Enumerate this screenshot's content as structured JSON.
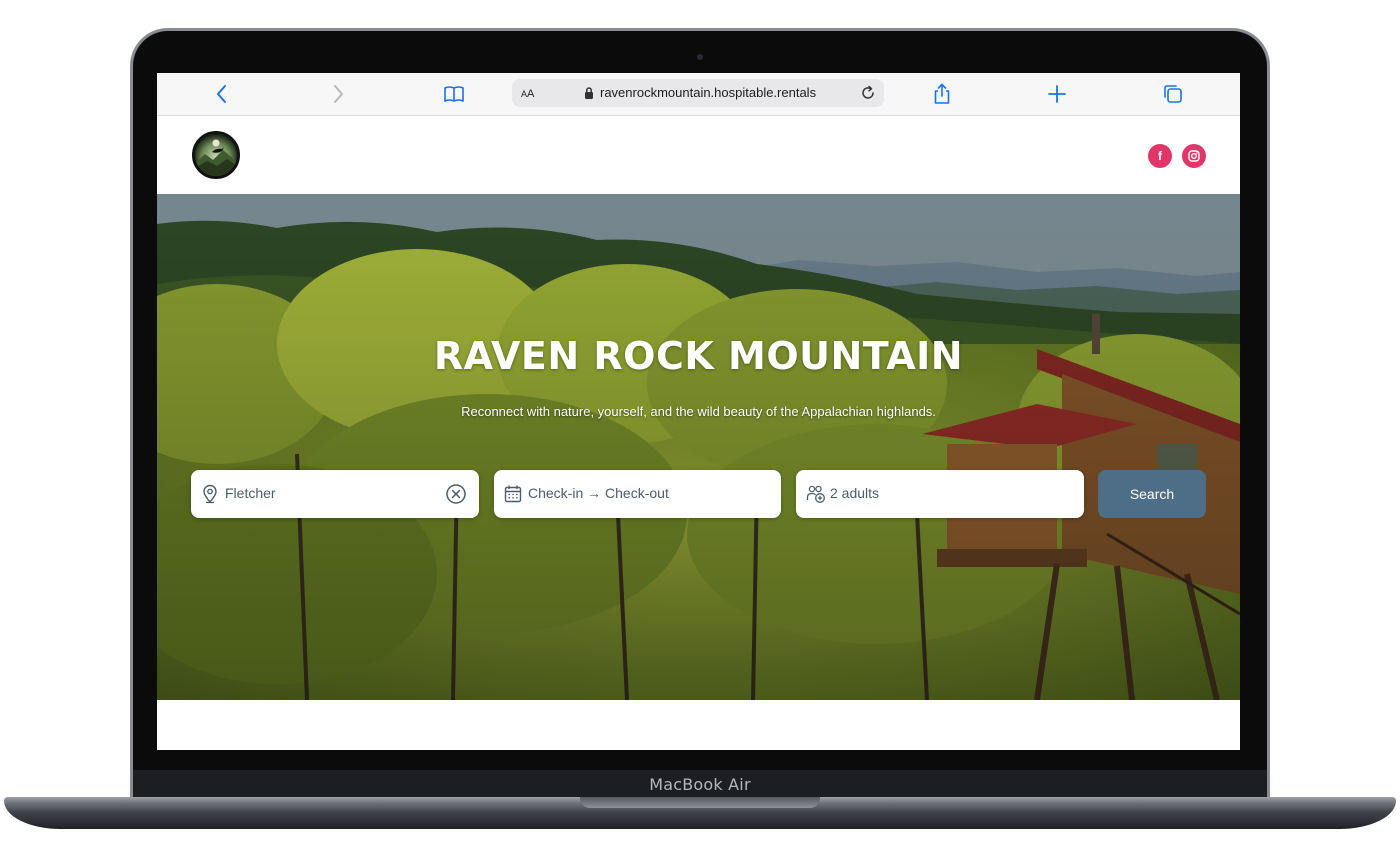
{
  "device": {
    "label": "MacBook Air"
  },
  "browser": {
    "text_size_label": "AA",
    "url": "ravenrockmountain.hospitable.rentals",
    "icons": [
      "back-icon",
      "forward-icon",
      "bookmarks-icon",
      "lock-icon",
      "reload-icon",
      "share-icon",
      "new-tab-icon",
      "tabs-icon"
    ]
  },
  "header": {
    "social": {
      "facebook_label": "f",
      "instagram_icon": "instagram-icon"
    },
    "social_color": "#e0366a"
  },
  "hero": {
    "title": "RAVEN ROCK MOUNTAIN",
    "subtitle": "Reconnect with nature, yourself, and the wild beauty of the Appalachian highlands."
  },
  "search": {
    "location_value": "Fletcher",
    "dates_placeholder": "Check-in → Check-out",
    "guests_value": "2 adults",
    "button_label": "Search",
    "button_color": "#4d6e86"
  }
}
